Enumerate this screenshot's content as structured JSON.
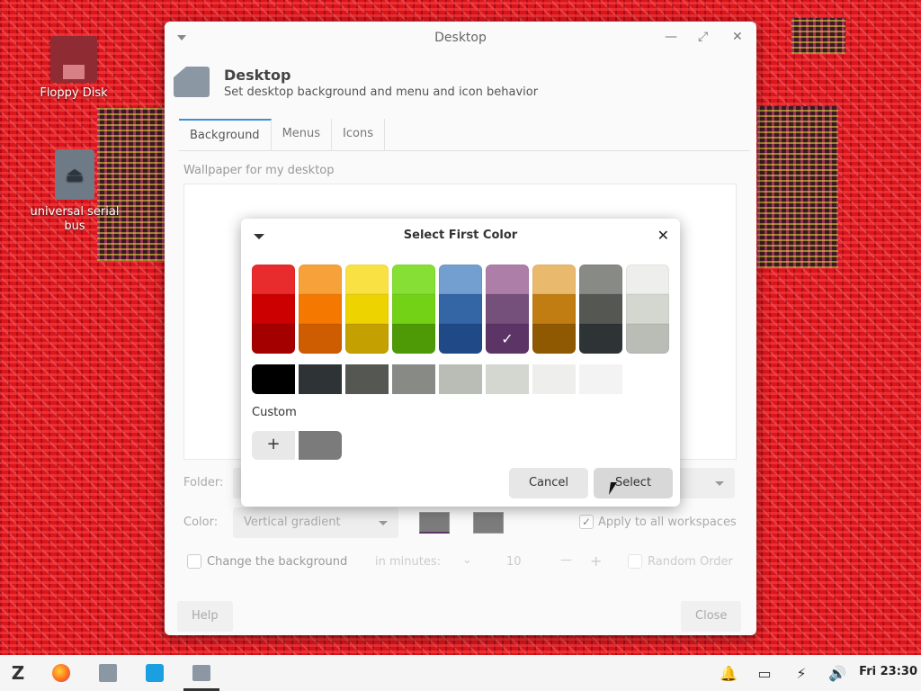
{
  "desktop": {
    "icons": [
      {
        "label": "Floppy Disk"
      },
      {
        "label": "universal serial bus"
      }
    ]
  },
  "window": {
    "title": "Desktop",
    "app_name": "Desktop",
    "app_description": "Set desktop background and menu and icon behavior",
    "tabs": [
      {
        "label": "Background",
        "active": true
      },
      {
        "label": "Menus",
        "active": false
      },
      {
        "label": "Icons",
        "active": false
      }
    ],
    "wallpaper_label": "Wallpaper for my desktop",
    "folder_label": "Folder:",
    "color_label": "Color:",
    "color_mode": "Vertical gradient",
    "apply_all": "Apply to all workspaces",
    "change_bg": "Change the background",
    "interval_unit": "in minutes:",
    "interval_value": "10",
    "random_order": "Random Order",
    "help_label": "Help",
    "close_label": "Close"
  },
  "dialog": {
    "title": "Select First Color",
    "custom_label": "Custom",
    "add_label": "+",
    "cancel_label": "Cancel",
    "select_label": "Select",
    "palette_columns": [
      [
        "#e82b2c",
        "#cc0000",
        "#a40000"
      ],
      [
        "#f7a13a",
        "#f57900",
        "#ce5c00"
      ],
      [
        "#f9e144",
        "#edd400",
        "#c4a000"
      ],
      [
        "#86df34",
        "#73d216",
        "#4e9a06"
      ],
      [
        "#729fcf",
        "#3465a4",
        "#204a87"
      ],
      [
        "#ad7fa8",
        "#75507b",
        "#5c3566"
      ],
      [
        "#e9b96e",
        "#c17d11",
        "#8f5902"
      ],
      [
        "#888a85",
        "#555753",
        "#2e3436"
      ],
      [
        "#eeeeec",
        "#d3d7cf",
        "#babdb6"
      ]
    ],
    "selected_swatch": "#5c3566",
    "gray_row": [
      "#000000",
      "#2e3436",
      "#555753",
      "#888a85",
      "#babdb6",
      "#d3d7cf",
      "#eeeeec",
      "#f3f3f3",
      "#ffffff"
    ],
    "custom_color": "#7b7b7b"
  },
  "taskbar": {
    "clock": "Fri 23:30"
  }
}
